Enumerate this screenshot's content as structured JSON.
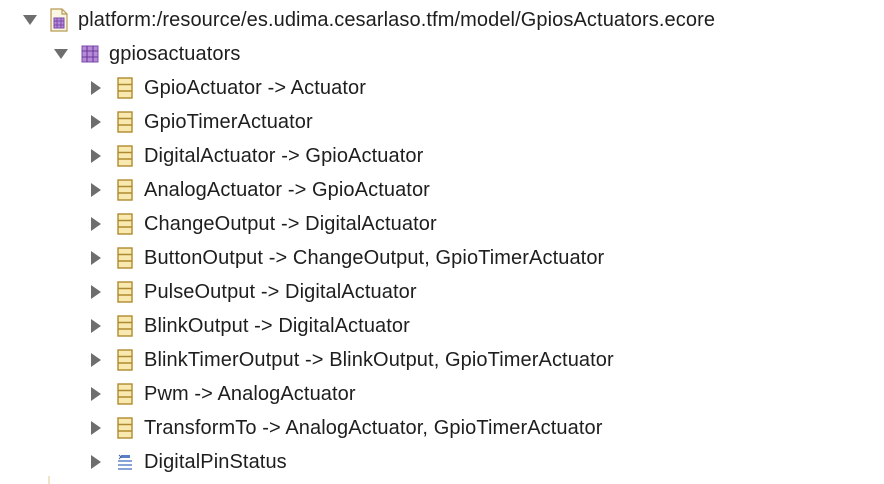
{
  "tree": {
    "root": {
      "label": "platform:/resource/es.udima.cesarlaso.tfm/model/GpiosActuators.ecore",
      "expanded": true,
      "icon": "ecore-resource-icon"
    },
    "package": {
      "label": "gpiosactuators",
      "expanded": true,
      "icon": "epackage-icon"
    },
    "items": [
      {
        "label": "GpioActuator -> Actuator",
        "type": "eclass"
      },
      {
        "label": "GpioTimerActuator",
        "type": "eclass"
      },
      {
        "label": "DigitalActuator -> GpioActuator",
        "type": "eclass"
      },
      {
        "label": "AnalogActuator -> GpioActuator",
        "type": "eclass"
      },
      {
        "label": "ChangeOutput -> DigitalActuator",
        "type": "eclass"
      },
      {
        "label": "ButtonOutput -> ChangeOutput, GpioTimerActuator",
        "type": "eclass"
      },
      {
        "label": "PulseOutput -> DigitalActuator",
        "type": "eclass"
      },
      {
        "label": "BlinkOutput -> DigitalActuator",
        "type": "eclass"
      },
      {
        "label": "BlinkTimerOutput -> BlinkOutput, GpioTimerActuator",
        "type": "eclass"
      },
      {
        "label": "Pwm -> AnalogActuator",
        "type": "eclass"
      },
      {
        "label": "TransformTo -> AnalogActuator, GpioTimerActuator",
        "type": "eclass"
      },
      {
        "label": "DigitalPinStatus",
        "type": "eenum"
      }
    ]
  },
  "colors": {
    "twisty": "#6e6e6e",
    "eclass_fill": "#f7e9b0",
    "eclass_stroke": "#b08a2e",
    "package_fill": "#b68ad8",
    "package_stroke": "#7a4aa8"
  }
}
